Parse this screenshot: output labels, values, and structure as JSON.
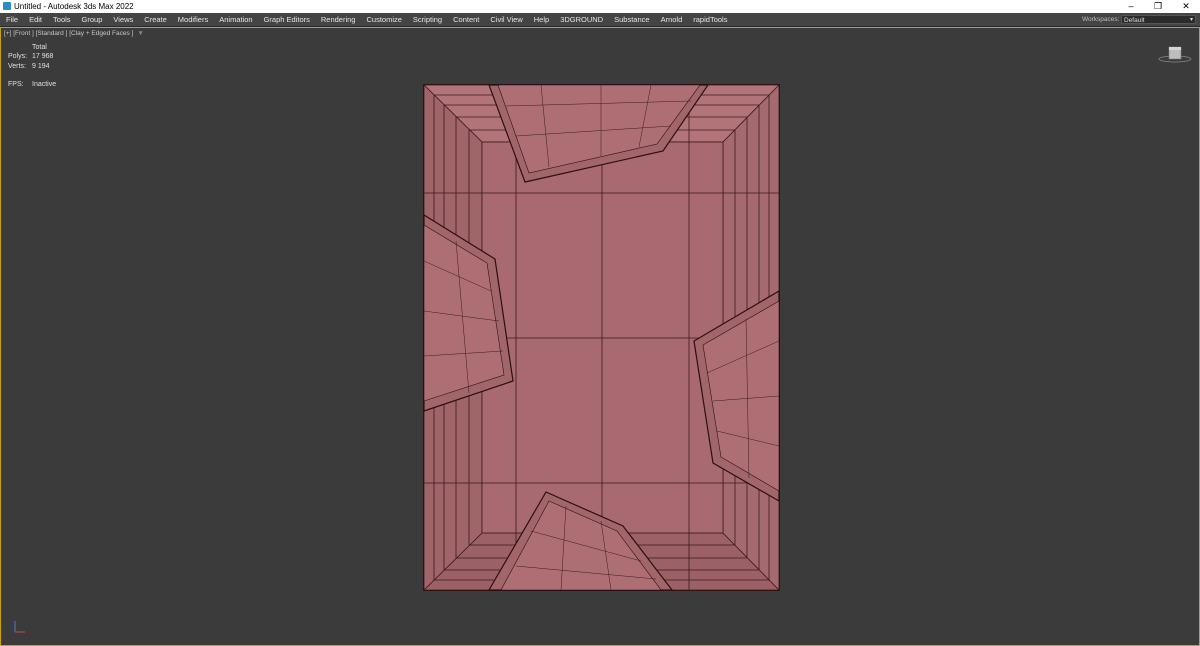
{
  "window": {
    "title": "Untitled - Autodesk 3ds Max 2022",
    "controls": [
      "–",
      "❐",
      "✕"
    ]
  },
  "menu": [
    "File",
    "Edit",
    "Tools",
    "Group",
    "Views",
    "Create",
    "Modifiers",
    "Animation",
    "Graph Editors",
    "Rendering",
    "Customize",
    "Scripting",
    "Content",
    "Civil View",
    "Help",
    "3DGROUND",
    "Substance",
    "Arnold",
    "rapidTools"
  ],
  "workspace": {
    "label": "Workspaces:",
    "value": "Default"
  },
  "viewport": {
    "label": "[+] [Front ] [Standard ] [Clay + Edged Faces ]",
    "stats": {
      "header": "Total",
      "polys_label": "Polys:",
      "polys": "17 968",
      "verts_label": "Verts:",
      "verts": "9 194",
      "fps_label": "FPS:",
      "fps": "Inactive"
    }
  },
  "colors": {
    "clay": "#a86a70",
    "edge": "#3a1a1c",
    "viewport_bg": "#3b3b3b",
    "active_border": "#c8a200"
  }
}
